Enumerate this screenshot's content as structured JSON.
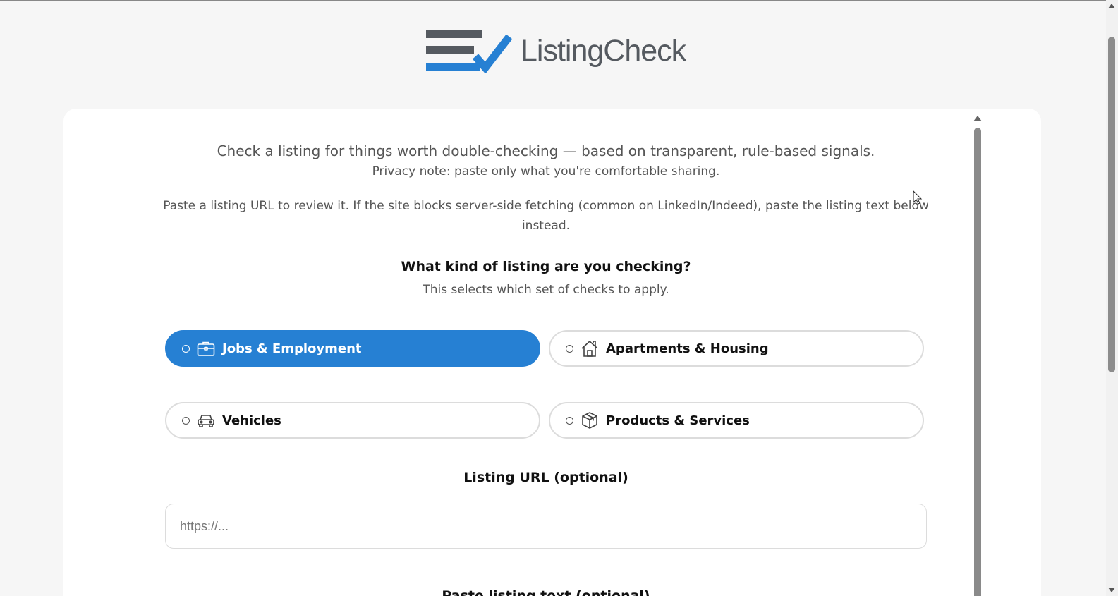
{
  "brand": {
    "name": "ListingCheck",
    "colors": {
      "bars": "#555a60",
      "accent": "#2680d3"
    }
  },
  "intro": {
    "headline": "Check a listing for things worth double-checking — based on transparent, rule-based signals.",
    "privacy": "Privacy note: paste only what you're comfortable sharing.",
    "instructions": "Paste a listing URL to review it. If the site blocks server-side fetching (common on LinkedIn/Indeed), paste the listing text below instead."
  },
  "category": {
    "question": "What kind of listing are you checking?",
    "subtitle": "This selects which set of checks to apply.",
    "options": [
      {
        "label": "Jobs & Employment",
        "icon": "briefcase-icon",
        "selected": true
      },
      {
        "label": "Apartments & Housing",
        "icon": "house-icon",
        "selected": false
      },
      {
        "label": "Vehicles",
        "icon": "car-icon",
        "selected": false
      },
      {
        "label": "Products & Services",
        "icon": "box-icon",
        "selected": false
      }
    ]
  },
  "url_field": {
    "label": "Listing URL (optional)",
    "placeholder": "https://...",
    "value": ""
  },
  "next_section": {
    "label": "Paste listing text (optional)"
  }
}
